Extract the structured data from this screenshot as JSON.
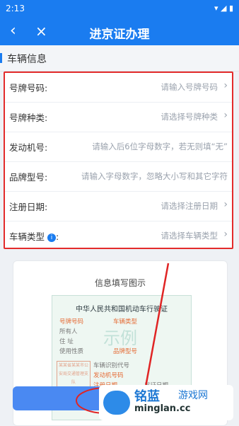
{
  "status": {
    "time": "2:13",
    "icons": "▾ ◢ ▮"
  },
  "nav": {
    "back": "‹",
    "close": "×",
    "title": "进京证办理"
  },
  "section": {
    "label": "车辆信息"
  },
  "form": {
    "rows": [
      {
        "label": "号牌号码:",
        "placeholder": "请输入号牌号码"
      },
      {
        "label": "号牌种类:",
        "placeholder": "请选择号牌种类"
      },
      {
        "label": "发动机号:",
        "placeholder": "请输入后6位字母数字，若无则填“无”"
      },
      {
        "label": "品牌型号:",
        "placeholder": "请输入字母数字，忽略大小写和其它字符"
      },
      {
        "label": "注册日期:",
        "placeholder": "请选择注册日期"
      },
      {
        "label": "车辆类型",
        "placeholder": "请选择车辆类型"
      }
    ]
  },
  "example": {
    "title": "信息填写图示",
    "card_title": "中华人民共和国机动车行驶证",
    "watermark": "示例",
    "lines": [
      {
        "a": "号牌号码",
        "b": "车辆类型"
      },
      {
        "a": "所有人",
        "b": ""
      },
      {
        "a": "住 址",
        "b": ""
      },
      {
        "a": "使用性质",
        "b": "品牌型号"
      },
      {
        "a": "",
        "b": "车辆识别代号"
      },
      {
        "a": "",
        "b": "发动机号码"
      },
      {
        "a": "",
        "b": "注册日期"
      }
    ],
    "extra": "发证日期",
    "stamp": "某某省某某市公安局交通管理支队"
  },
  "watermark_logo": {
    "brand": "铭蓝",
    "game": "游戏网",
    "url": "minglan.cc"
  },
  "colors": {
    "primary": "#1a7cf0",
    "highlight": "#e32b2b"
  }
}
